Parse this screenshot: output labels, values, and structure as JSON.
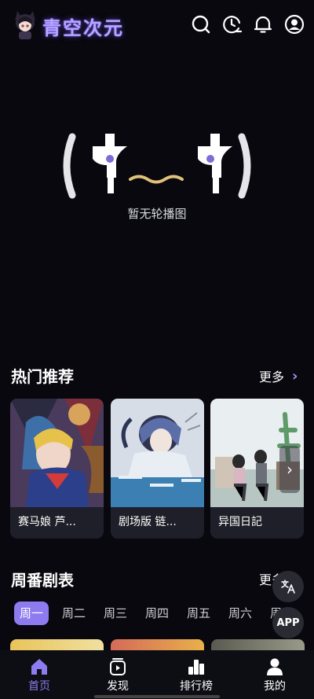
{
  "app": {
    "logo_text": "青空次元"
  },
  "header_icons": [
    "search-icon",
    "history-icon",
    "bell-icon",
    "user-icon"
  ],
  "banner": {
    "face_text": "(ф﹏ф)",
    "empty_text": "暂无轮播图"
  },
  "hot": {
    "title": "热门推荐",
    "more_label": "更多",
    "items": [
      {
        "title": "赛马娘 芦..."
      },
      {
        "title": "剧场版 链..."
      },
      {
        "title": "异国日記"
      }
    ]
  },
  "weekly": {
    "title": "周番剧表",
    "more_label": "更多",
    "days": [
      "周一",
      "周二",
      "周三",
      "周四",
      "周五",
      "周六",
      "周日"
    ],
    "active_day": "周一"
  },
  "fabs": {
    "translate_icon": "translate-icon",
    "app_label": "APP"
  },
  "tabs": [
    {
      "label": "首页",
      "icon": "home-icon",
      "active": true
    },
    {
      "label": "发现",
      "icon": "discover-icon",
      "active": false
    },
    {
      "label": "排行榜",
      "icon": "ranking-icon",
      "active": false
    },
    {
      "label": "我的",
      "icon": "profile-icon",
      "active": false
    }
  ],
  "colors": {
    "accent": "#8e7bef",
    "background": "#08080e",
    "logo": "#b7a6ff"
  }
}
